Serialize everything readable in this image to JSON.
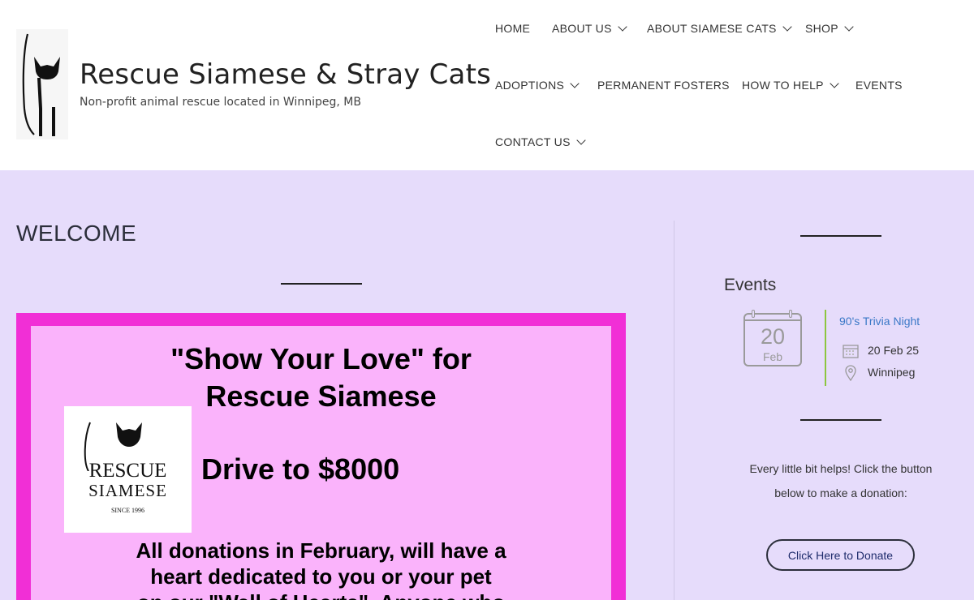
{
  "site": {
    "title": "Rescue Siamese & Stray Cats",
    "tagline": "Non-profit animal rescue located in Winnipeg, MB"
  },
  "nav": {
    "home": "HOME",
    "about_us": "ABOUT US",
    "about_siamese": "ABOUT SIAMESE CATS",
    "shop": "SHOP",
    "adoptions": "ADOPTIONS",
    "permanent_fosters": "PERMANENT FOSTERS",
    "how_to_help": "HOW TO HELP",
    "events": "EVENTS",
    "contact_us": "CONTACT US"
  },
  "main": {
    "heading": "WELCOME",
    "poster": {
      "line1": "\"Show Your Love\" for",
      "line2": "Rescue Siamese",
      "drive": "Drive to $8000",
      "body1": "All donations in February, will have a",
      "body2": "heart dedicated to you or your pet",
      "body3": "on our \"Wall of Hearts\". Anyone who",
      "logo_rescue": "RESCUE",
      "logo_siamese": "SIAMESE",
      "logo_since": "SINCE 1996"
    }
  },
  "sidebar": {
    "events_title": "Events",
    "event": {
      "day": "20",
      "month": "Feb",
      "name": "90's Trivia Night",
      "date": "20 Feb 25",
      "location": "Winnipeg"
    },
    "donate_line1": "Every little bit helps! Click the button",
    "donate_line2": "below to make a donation:",
    "donate_button": "Click Here to Donate"
  },
  "colors": {
    "page_bg": "#e6dcfb",
    "poster_border": "#f12fd6",
    "poster_fill": "#fab3fb",
    "event_link": "#3a78c7",
    "event_accent": "#8cc63f"
  }
}
